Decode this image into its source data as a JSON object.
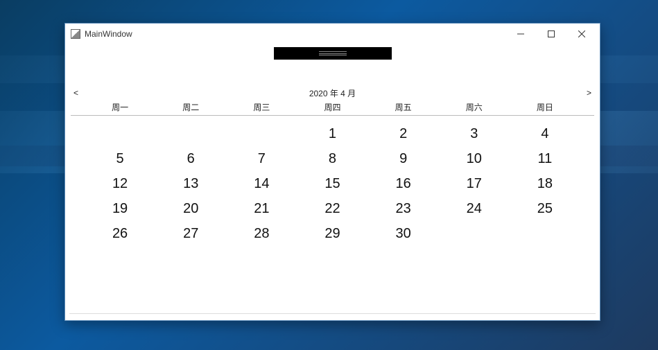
{
  "window": {
    "title": "MainWindow"
  },
  "calendar": {
    "nav_prev": "<",
    "nav_next": ">",
    "month_label": "2020 年 4 月",
    "day_headers": [
      "周一",
      "周二",
      "周三",
      "周四",
      "周五",
      "周六",
      "周日"
    ],
    "weeks": [
      [
        "",
        "",
        "",
        "1",
        "2",
        "3",
        "4"
      ],
      [
        "5",
        "6",
        "7",
        "8",
        "9",
        "10",
        "11"
      ],
      [
        "12",
        "13",
        "14",
        "15",
        "16",
        "17",
        "18"
      ],
      [
        "19",
        "20",
        "21",
        "22",
        "23",
        "24",
        "25"
      ],
      [
        "26",
        "27",
        "28",
        "29",
        "30",
        "",
        ""
      ]
    ]
  }
}
